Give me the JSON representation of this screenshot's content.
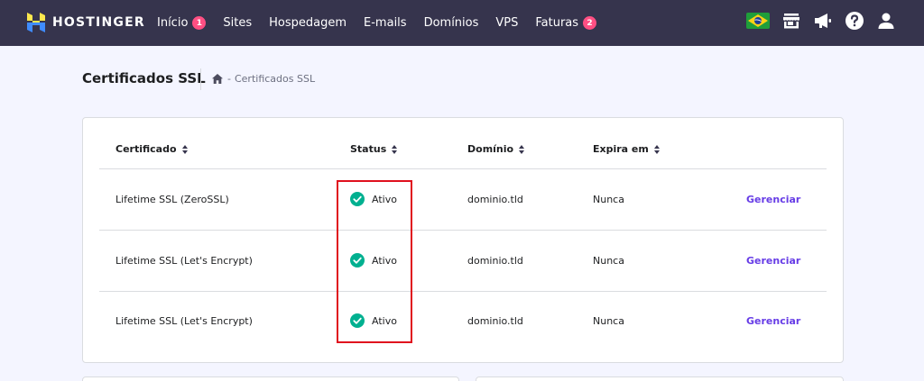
{
  "brand": {
    "name": "HOSTINGER",
    "logo_icon": "hostinger-logo-icon"
  },
  "nav": {
    "items": [
      {
        "label": "Início",
        "badge": "1"
      },
      {
        "label": "Sites"
      },
      {
        "label": "Hospedagem"
      },
      {
        "label": "E-mails"
      },
      {
        "label": "Domínios"
      },
      {
        "label": "VPS"
      },
      {
        "label": "Faturas",
        "badge": "2"
      }
    ],
    "icons": [
      "brazil-flag-icon",
      "store-icon",
      "megaphone-icon",
      "help-icon",
      "user-icon"
    ]
  },
  "page": {
    "title": "Certificados SSL",
    "breadcrumb": {
      "home_icon": "home-icon",
      "separator": "-",
      "current": "Certificados SSL"
    }
  },
  "table": {
    "columns": [
      "Certificado",
      "Status",
      "Domínio",
      "Expira em"
    ],
    "rows": [
      {
        "certificate": "Lifetime SSL (ZeroSSL)",
        "status": "Ativo",
        "domain": "dominio.tld",
        "expires": "Nunca",
        "action": "Gerenciar"
      },
      {
        "certificate": "Lifetime SSL (Let's Encrypt)",
        "status": "Ativo",
        "domain": "dominio.tld",
        "expires": "Nunca",
        "action": "Gerenciar"
      },
      {
        "certificate": "Lifetime SSL (Let's Encrypt)",
        "status": "Ativo",
        "domain": "dominio.tld",
        "expires": "Nunca",
        "action": "Gerenciar"
      }
    ]
  },
  "colors": {
    "topbar": "#36344d",
    "accent": "#673de6",
    "status_ok": "#00b090",
    "badge": "#ff4f83",
    "highlight": "#e0101e",
    "page_background": "#f4f5ff"
  }
}
